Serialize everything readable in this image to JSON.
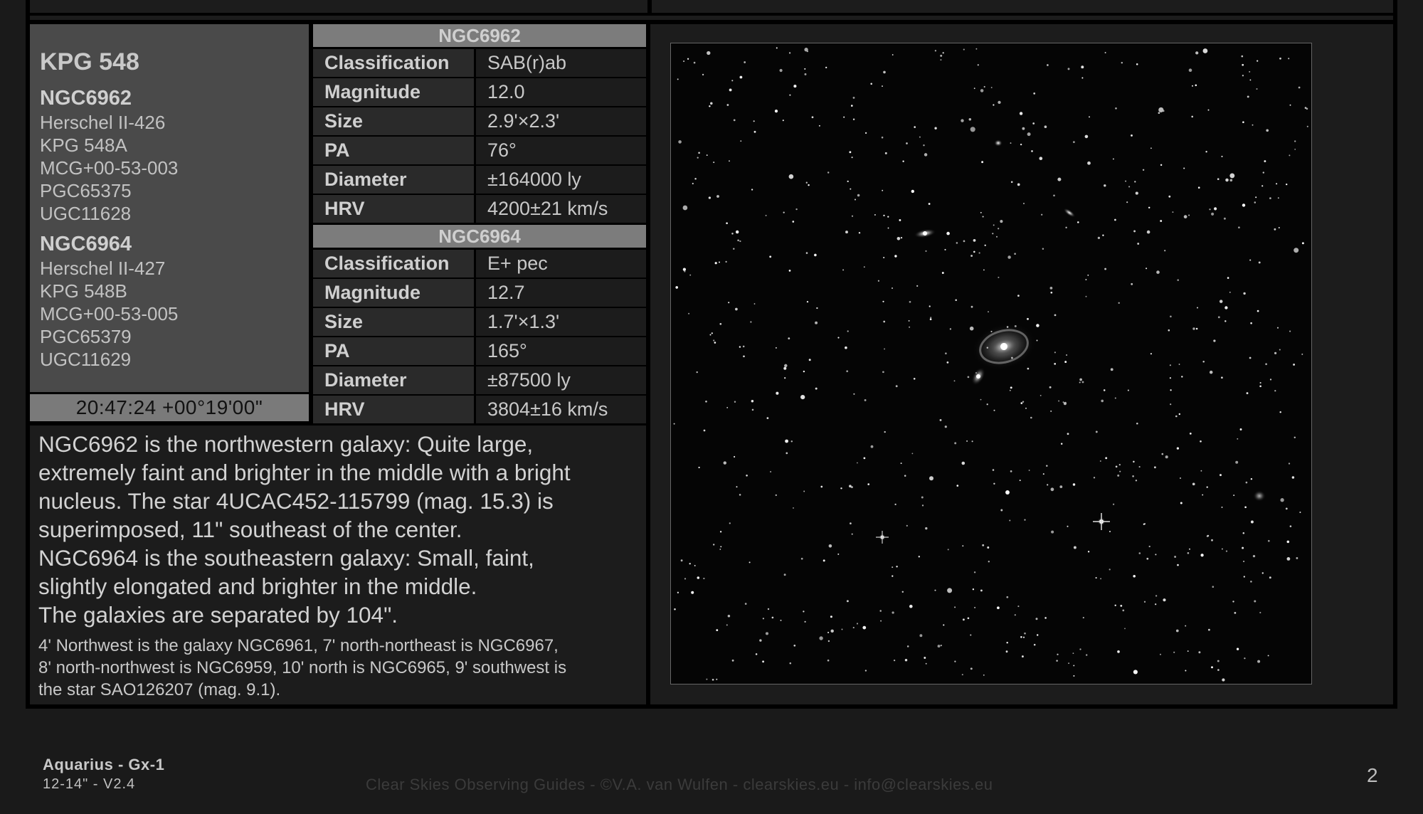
{
  "info": {
    "title": "KPG 548",
    "galaxy1": {
      "name": "NGC6962",
      "aliases": [
        "Herschel II-426",
        "KPG 548A",
        "MCG+00-53-003",
        "PGC65375",
        "UGC11628"
      ]
    },
    "galaxy2": {
      "name": "NGC6964",
      "aliases": [
        "Herschel II-427",
        "KPG 548B",
        "MCG+00-53-005",
        "PGC65379",
        "UGC11629"
      ]
    },
    "coordinates": "20:47:24 +00°19'00\""
  },
  "table1": {
    "header": "NGC6962",
    "rows": [
      {
        "key": "Classification",
        "value": "SAB(r)ab"
      },
      {
        "key": "Magnitude",
        "value": "12.0"
      },
      {
        "key": "Size",
        "value": "2.9'×2.3'"
      },
      {
        "key": "PA",
        "value": "76°"
      },
      {
        "key": "Diameter",
        "value": "±164000 ly"
      },
      {
        "key": "HRV",
        "value": "4200±21 km/s"
      }
    ]
  },
  "table2": {
    "header": "NGC6964",
    "rows": [
      {
        "key": "Classification",
        "value": "E+ pec"
      },
      {
        "key": "Magnitude",
        "value": "12.7"
      },
      {
        "key": "Size",
        "value": "1.7'×1.3'"
      },
      {
        "key": "PA",
        "value": "165°"
      },
      {
        "key": "Diameter",
        "value": "±87500 ly"
      },
      {
        "key": "HRV",
        "value": "3804±16 km/s"
      }
    ]
  },
  "description": {
    "main_lines": [
      "NGC6962 is the northwestern galaxy: Quite large,",
      "extremely faint and brighter in the middle with a bright",
      "nucleus. The star 4UCAC452-115799 (mag. 15.3) is",
      "superimposed, 11\" southeast of the center.",
      "NGC6964 is the southeastern galaxy: Small, faint,",
      "slightly elongated and brighter in the middle.",
      "The galaxies are separated by 104\"."
    ],
    "note_lines": [
      "4' Northwest is the galaxy NGC6961, 7' north-northeast is NGC6967,",
      "8' north-northwest is NGC6959, 10' north is NGC6965, 9' southwest is",
      "the star SAO126207 (mag. 9.1)."
    ]
  },
  "footer": {
    "title": "Aquarius - Gx-1",
    "subtitle": "12-14\" - V2.4",
    "credit": "Clear Skies Observing Guides - ©V.A. van Wulfen - clearskies.eu - info@clearskies.eu",
    "page": "2"
  }
}
